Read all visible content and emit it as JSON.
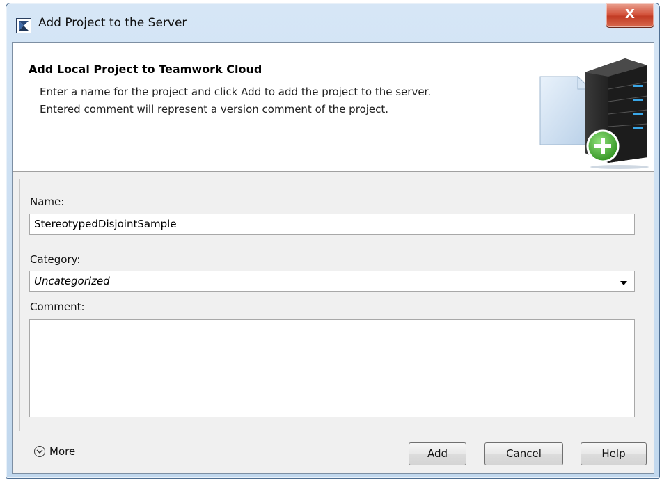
{
  "window": {
    "title": "Add Project to the Server",
    "close_glyph": "X"
  },
  "header": {
    "title": "Add Local Project to Teamwork Cloud",
    "description_line1": "Enter a name for the project and click Add to add the project to the server.",
    "description_line2": "Entered comment will represent a version comment of the project.",
    "illustration_icon": "server-add-icon"
  },
  "form": {
    "name_label": "Name:",
    "name_value": "StereotypedDisjointSample",
    "category_label": "Category:",
    "category_value": "Uncategorized",
    "comment_label": "Comment:",
    "comment_value": ""
  },
  "footer": {
    "more_label": "More",
    "more_icon": "chevron-down-circle-icon",
    "add_label": "Add",
    "cancel_label": "Cancel",
    "help_label": "Help"
  },
  "colors": {
    "accent_green": "#3fa42c",
    "server_dark": "#222222",
    "server_led": "#3aa7e8",
    "close_red": "#c94c34"
  }
}
